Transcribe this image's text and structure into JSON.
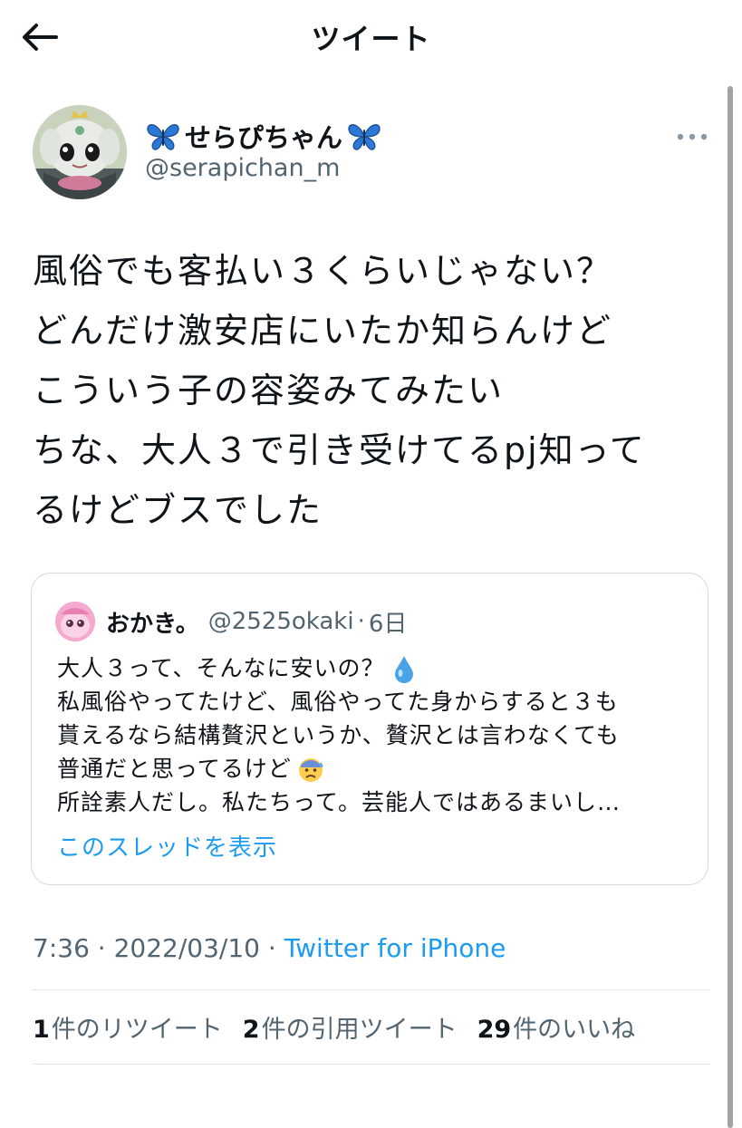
{
  "header": {
    "title": "ツイート"
  },
  "author": {
    "name": "せらぴちゃん",
    "handle": "@serapichan_m"
  },
  "tweet": {
    "lines": [
      "風俗でも客払い３くらいじゃない？",
      "どんだけ激安店にいたか知らんけど",
      "こういう子の容姿みてみたい",
      "ちな、大人３で引き受けてるpj知って",
      "るけどブスでした"
    ]
  },
  "quote": {
    "name": "おかき。",
    "handle": "@2525okaki",
    "dot": "·",
    "time": "6日",
    "lines": [
      "大人３って、そんなに安いの？",
      "私風俗やってたけど、風俗やってた身からすると３も",
      "貰えるなら結構贅沢というか、贅沢とは言わなくても",
      "普通だと思ってるけど",
      "所詮素人だし。私たちって。芸能人ではあるまいし…"
    ],
    "show_thread": "このスレッドを表示"
  },
  "meta": {
    "time": "7:36",
    "sep1": " · ",
    "date": "2022/03/10",
    "sep2": " · ",
    "source": "Twitter for iPhone"
  },
  "stats": {
    "retweets_count": "1",
    "retweets_label": "件のリツイート",
    "quotes_count": "2",
    "quotes_label": "件の引用ツイート",
    "likes_count": "29",
    "likes_label": "件のいいね"
  },
  "colors": {
    "accent": "#1d9bf0",
    "text_primary": "#0f1419",
    "text_secondary": "#536471",
    "border": "#cfd9de"
  },
  "icons": {
    "back": "back-arrow-icon",
    "more": "more-horizontal-icon",
    "name_decoration": "butterfly-emoji-icon",
    "quote_emoji_1": "droplet-emoji-icon",
    "quote_emoji_2": "anxious-face-emoji-icon"
  }
}
